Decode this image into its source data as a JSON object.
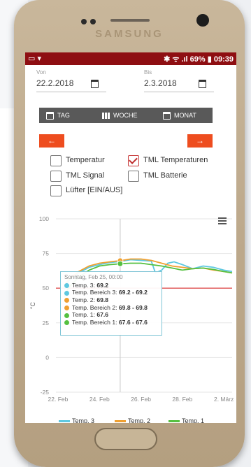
{
  "device": {
    "brand": "SAMSUNG"
  },
  "status_bar": {
    "left_icons": "▭ ▾",
    "right": "✱ ᯤ .ıl 69% ▮ 09:39",
    "battery": "69%",
    "time": "09:39"
  },
  "date_range": {
    "from_label": "Von",
    "from_value": "22.2.2018",
    "to_label": "Bis",
    "to_value": "2.3.2018"
  },
  "period_buttons": {
    "day": "TAG",
    "week": "WOCHE",
    "month": "MONAT"
  },
  "nav": {
    "prev": "←",
    "next": "→"
  },
  "options": [
    {
      "label": "Temperatur",
      "checked": false
    },
    {
      "label": "TML Temperaturen",
      "checked": true
    },
    {
      "label": "TML Signal",
      "checked": false
    },
    {
      "label": "TML Batterie",
      "checked": false
    },
    {
      "label": "Lüfter [EIN/AUS]",
      "checked": false
    }
  ],
  "tooltip": {
    "header": "Sonntag, Feb 25, 00:00",
    "rows": [
      {
        "label": "Temp. 3: ",
        "value": "69.2",
        "color": "#5ec8e0"
      },
      {
        "label": "Temp. Bereich 3: ",
        "value": "69.2 - 69.2",
        "color": "#5ec8e0"
      },
      {
        "label": "Temp. 2: ",
        "value": "69.8",
        "color": "#f0a030"
      },
      {
        "label": "Temp. Bereich 2: ",
        "value": "69.8 - 69.8",
        "color": "#f0a030"
      },
      {
        "label": "Temp. 1: ",
        "value": "67.6",
        "color": "#55c040"
      },
      {
        "label": "Temp. Bereich 1: ",
        "value": "67.6 - 67.6",
        "color": "#55c040"
      }
    ]
  },
  "legend": [
    "Temp. 3",
    "Temp. 2",
    "Temp. 1"
  ],
  "chart_data": {
    "type": "line",
    "ylabel": "°C",
    "ylim": [
      -25,
      100
    ],
    "yticks": [
      -25,
      0,
      25,
      50,
      75,
      100
    ],
    "xlim": [
      21.9,
      30.4
    ],
    "xtick_labels": [
      "22. Feb",
      "24. Feb",
      "26. Feb",
      "28. Feb",
      "2. März"
    ],
    "xtick_values": [
      22,
      24,
      26,
      28,
      30
    ],
    "threshold": {
      "value": 50,
      "color": "#e05050"
    },
    "crosshair_x": 25,
    "series": [
      {
        "name": "Temp. 3",
        "color": "#5ec8e0",
        "x": [
          22.3,
          22.5,
          23,
          23.5,
          24,
          24.5,
          25,
          25.5,
          26,
          26.5,
          26.7,
          27,
          27.3,
          27.6,
          28,
          28.5,
          29,
          29.5,
          30,
          30.4
        ],
        "y": [
          49,
          55,
          61,
          65,
          67,
          68.5,
          69.2,
          70.5,
          70,
          69.5,
          61,
          63,
          68,
          69,
          67,
          64,
          66,
          65,
          63,
          62
        ]
      },
      {
        "name": "Temp. 2",
        "color": "#f0a030",
        "x": [
          22.3,
          22.5,
          23,
          23.5,
          24,
          24.5,
          25,
          25.5,
          26,
          26.5,
          27,
          27.5,
          28,
          28.5,
          29,
          29.5,
          30,
          30.4
        ],
        "y": [
          52,
          56,
          62,
          66,
          68,
          69,
          69.8,
          71,
          71,
          70,
          68,
          66,
          65,
          64,
          64.5,
          63,
          62,
          61
        ]
      },
      {
        "name": "Temp. 1",
        "color": "#55c040",
        "x": [
          22.3,
          22.5,
          23,
          23.5,
          24,
          24.5,
          25,
          25.5,
          26,
          26.5,
          27,
          27.5,
          28,
          28.5,
          29,
          29.5,
          30,
          30.4
        ],
        "y": [
          44,
          50,
          58,
          63,
          66,
          67,
          67.6,
          68,
          68,
          67,
          66,
          64.5,
          63,
          64,
          64.5,
          63.5,
          62,
          61
        ]
      }
    ]
  }
}
